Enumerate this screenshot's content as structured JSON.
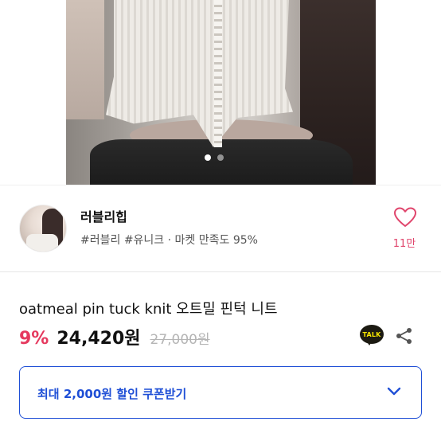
{
  "gallery": {
    "image_alt": "",
    "dots_total": 2,
    "active_dot": 1
  },
  "shop": {
    "name": "러블리힙",
    "meta": "#러블리 #유니크 · 마켓 만족도 95%",
    "likes": "11만",
    "heart_color": "#e0456c"
  },
  "product": {
    "title": "oatmeal pin tuck knit 오트밀 핀턱 니트",
    "discount": "9%",
    "price": "24,420원",
    "original_price": "27,000원"
  },
  "actions": {
    "talk_label": "TALK",
    "share_icon": "share-icon"
  },
  "coupon": {
    "label": "최대 2,000원 할인 쿠폰받기",
    "accent": "#1f4fd6"
  }
}
